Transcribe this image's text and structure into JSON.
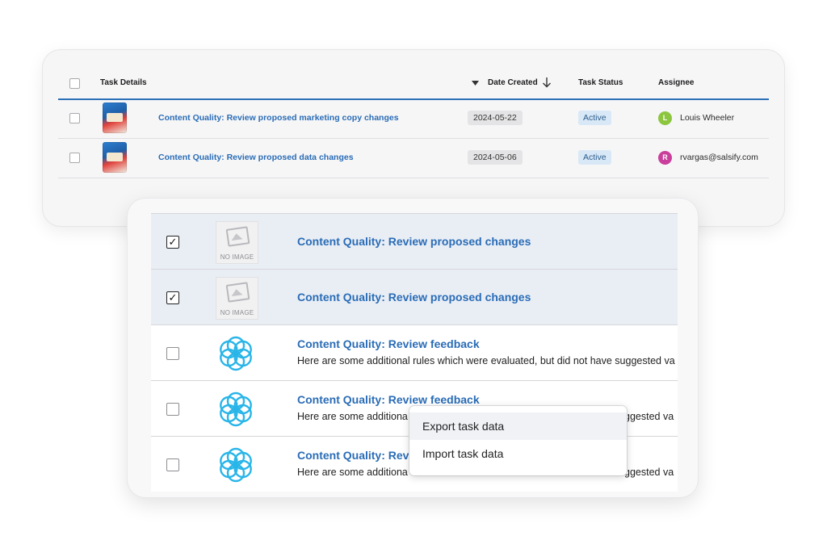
{
  "table": {
    "headers": {
      "task_details": "Task Details",
      "date_created": "Date Created",
      "task_status": "Task Status",
      "assignee": "Assignee"
    },
    "rows": [
      {
        "title": "Content Quality: Review proposed marketing copy changes",
        "date": "2024-05-22",
        "status": "Active",
        "avatar_letter": "L",
        "avatar_color": "#8cc63f",
        "assignee": "Louis Wheeler"
      },
      {
        "title": "Content Quality: Review proposed data changes",
        "date": "2024-05-06",
        "status": "Active",
        "avatar_letter": "R",
        "avatar_color": "#c93f9b",
        "assignee": "rvargas@salsify.com"
      }
    ]
  },
  "task_list": {
    "no_image_label": "NO IMAGE",
    "rows": [
      {
        "checked": true,
        "title": "Content Quality: Review proposed changes",
        "description": ""
      },
      {
        "checked": true,
        "title": "Content Quality: Review proposed changes",
        "description": ""
      },
      {
        "checked": false,
        "title": "Content Quality: Review feedback",
        "description": "Here are some additional rules which were evaluated, but did not have suggested va"
      },
      {
        "checked": false,
        "title": "Content Quality: Review feedback",
        "description": "Here are some additiona",
        "description_tail": "ggested va"
      },
      {
        "checked": false,
        "title": "Content Quality: Revi",
        "description": "Here are some additiona",
        "description_tail": "ggested va"
      }
    ]
  },
  "context_menu": {
    "items": [
      "Export task data",
      "Import task data"
    ]
  },
  "colors": {
    "link": "#2a6cb6",
    "accent_rule": "#2b6fb8",
    "selected_row": "#e9eef5",
    "flower_icon": "#29b5e8"
  }
}
